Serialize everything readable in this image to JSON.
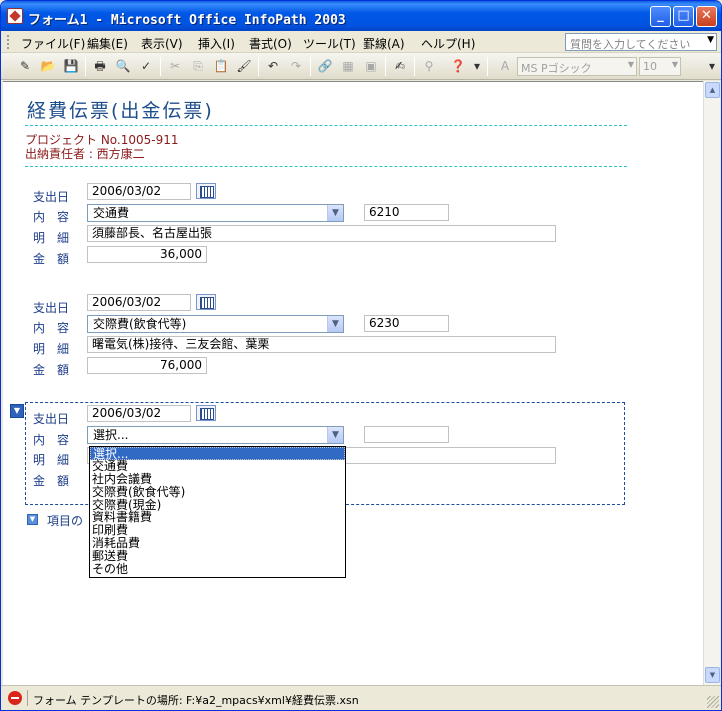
{
  "window": {
    "title": "フォーム1 - Microsoft Office InfoPath 2003"
  },
  "menu": {
    "items": [
      "ファイル(F)",
      "編集(E)",
      "表示(V)",
      "挿入(I)",
      "書式(O)",
      "ツール(T)",
      "罫線(A)",
      "ヘルプ(H)"
    ],
    "help_placeholder": "質問を入力してください"
  },
  "toolbar": {
    "font_name": "MS Pゴシック",
    "font_size": "10"
  },
  "form": {
    "title": "経費伝票(出金伝票)",
    "project": "プロジェクト No.1005-911",
    "manager": "出納責任者 : 西方康二",
    "labels": {
      "date": "支出日",
      "content": "内　容",
      "detail": "明　細",
      "amount": "金　額"
    },
    "entries": [
      {
        "date": "2006/03/02",
        "category": "交通費",
        "code": "6210",
        "detail": "須藤部長、名古屋出張",
        "amount": "36,000"
      },
      {
        "date": "2006/03/02",
        "category": "交際費(飲食代等)",
        "code": "6230",
        "detail": "曙電気(株)接待、三友会館、葉栗",
        "amount": "76,000"
      },
      {
        "date": "2006/03/02",
        "category": "選択...",
        "code": "",
        "detail": "",
        "amount": ""
      }
    ],
    "add_item_text": "項目の",
    "dropdown_options": [
      "選択...",
      "交通費",
      "社内会議費",
      "交際費(飲食代等)",
      "交際費(現金)",
      "資料書籍費",
      "印刷費",
      "消耗品費",
      "郵送費",
      "その他"
    ],
    "dropdown_selected": "選択..."
  },
  "status": {
    "text": "フォーム テンプレートの場所: F:¥a2_mpacs¥xml¥経費伝票.xsn"
  }
}
